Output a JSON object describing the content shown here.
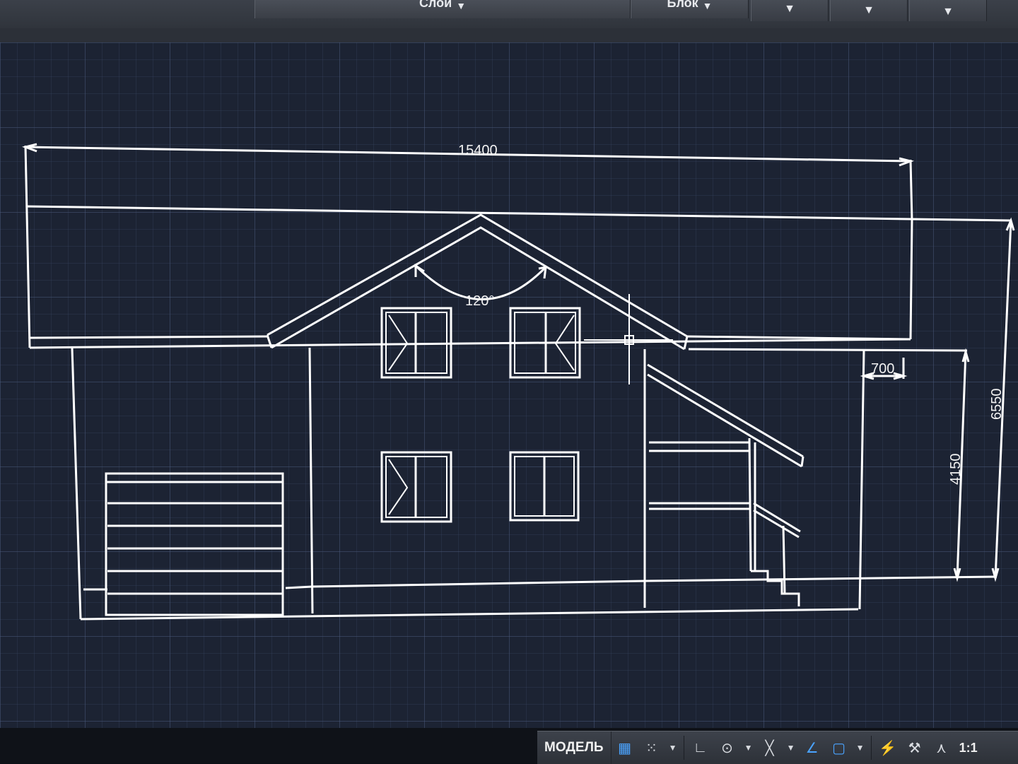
{
  "ribbon": {
    "layers_label": "Слои",
    "block_label": "Блок",
    "dropdown_arrow": "▼"
  },
  "drawing": {
    "dim_overall_width": "15400",
    "dim_roof_angle": "120°",
    "dim_overhang": "700",
    "dim_wall_height": "4150",
    "dim_total_height": "6550"
  },
  "statusbar": {
    "model_tab": "МОДЕЛЬ",
    "annotation_scale": "1:1",
    "icons": [
      "grid-icon",
      "snap-icon",
      "ortho-icon",
      "polar-icon",
      "isodraft-icon",
      "osnap-icon",
      "lineweight-icon",
      "annotation-visibility-icon",
      "auto-scale-icon",
      "annotation-scale-icon"
    ]
  },
  "colors": {
    "canvas": "#1c2333",
    "linework": "#ffffff",
    "accent_blue": "#4aa3ff"
  }
}
